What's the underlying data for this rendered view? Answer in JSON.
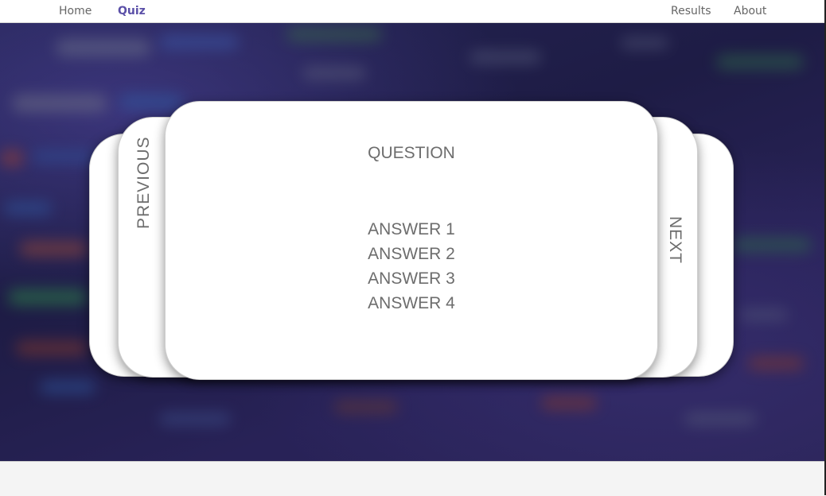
{
  "nav": {
    "home": "Home",
    "quiz": "Quiz",
    "results": "Results",
    "about": "About"
  },
  "quiz": {
    "question": "QUESTION",
    "answers": [
      "ANSWER 1",
      "ANSWER 2",
      "ANSWER 3",
      "ANSWER 4"
    ],
    "previous_label": "PREVIOUS",
    "next_label": "NEXT"
  },
  "colors": {
    "accent": "#5b50a8",
    "background": "#221f4e",
    "card": "#ffffff",
    "text": "#6d6d6d"
  }
}
